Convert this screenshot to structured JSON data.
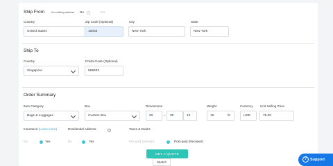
{
  "ship_from": {
    "title": "Ship From",
    "existing_address_label": "An existing address",
    "existing_no": "No",
    "existing_yes": "Yes",
    "country_label": "Country",
    "country_value": "United States",
    "zip_label": "Zip Code (Optional)",
    "zip_value": "10003",
    "city_label": "City",
    "city_value": "New York",
    "state_label": "State",
    "state_value": "New York"
  },
  "ship_to": {
    "title": "Ship To",
    "country_label": "Country",
    "country_value": "Singapore",
    "postal_label": "Postal Code (Optional)",
    "postal_value": "569933"
  },
  "order": {
    "title": "Order Summary",
    "item_category_label": "Item Category",
    "item_category_value": "Bags & Luggages",
    "box_label": "Box",
    "box_value": "Custom Box",
    "dimensions_label": "Dimensions",
    "dim_1": "20",
    "dim_2": "30",
    "dim_3": "10",
    "dim_x": "x",
    "weight_label": "Weight",
    "weight_value": "15",
    "weight_unit": "lb",
    "currency_label": "Currency",
    "currency_value": "USD",
    "unit_price_label": "Unit Selling Price",
    "unit_price_value": "75.00",
    "insurance_label": "Insurance",
    "insurance_learn": "(Learn more)",
    "insurance_no": "No",
    "insurance_yes": "Yes",
    "residential_label": "Residential Address",
    "residential_no": "No",
    "residential_yes": "Yes",
    "taxes_label": "Taxes & Duties",
    "taxes_prepaid_sender": "Pre-paid (Sender)",
    "taxes_postpaid_receiver": "Post-paid (Receiver)"
  },
  "actions": {
    "get_quote": "GET A QUOTE",
    "sketch": "Sketch",
    "support": "Support"
  },
  "colors": {
    "accent": "#2ec4b6",
    "radio": "#43c6d4",
    "support": "#1677e6",
    "zip_bg": "#e8f1fb"
  }
}
